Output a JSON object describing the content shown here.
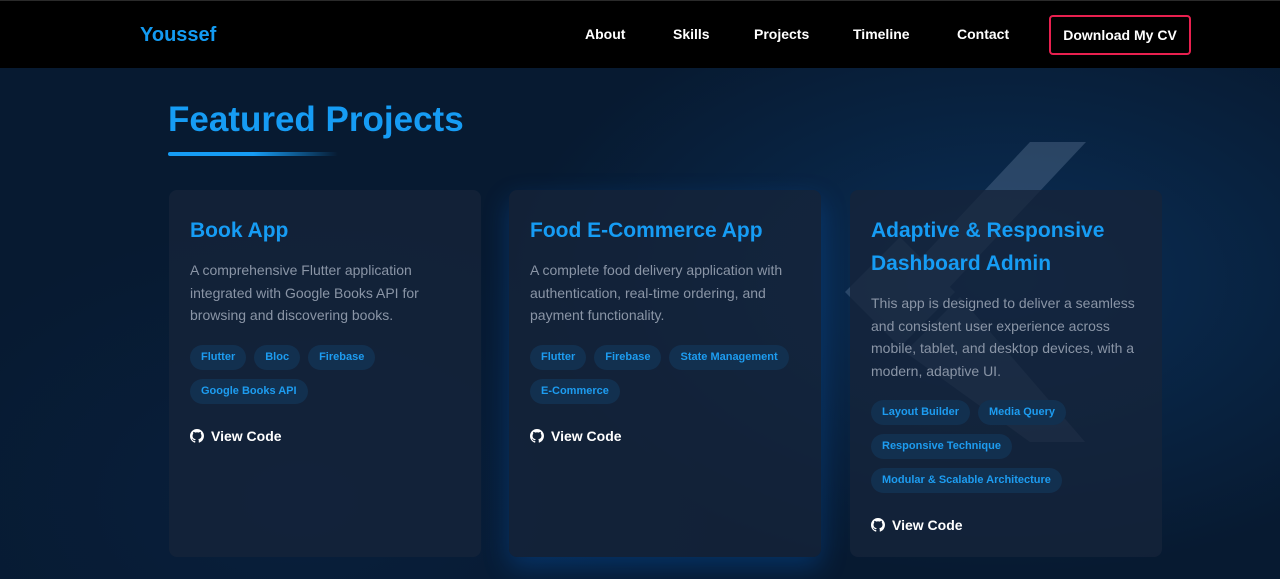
{
  "navbar": {
    "brand": "Youssef",
    "links": [
      {
        "label": "About"
      },
      {
        "label": "Skills"
      },
      {
        "label": "Projects"
      },
      {
        "label": "Timeline"
      },
      {
        "label": "Contact"
      }
    ],
    "cv_button": "Download My CV",
    "accent_color": "#139bf2",
    "cv_border_color": "#e8204f"
  },
  "section": {
    "title": "Featured Projects"
  },
  "projects": [
    {
      "title": "Book App",
      "description": "A comprehensive Flutter application integrated with Google Books API for browsing and discovering books.",
      "tags": [
        "Flutter",
        "Bloc",
        "Firebase",
        "Google Books API"
      ],
      "link_label": "View Code",
      "icon": "github-icon"
    },
    {
      "title": "Food E-Commerce App",
      "description": "A complete food delivery application with authentication, real-time ordering, and payment functionality.",
      "tags": [
        "Flutter",
        "Firebase",
        "State Management",
        "E-Commerce"
      ],
      "link_label": "View Code",
      "icon": "github-icon"
    },
    {
      "title": "Adaptive & Responsive Dashboard Admin",
      "description": "This app is designed to deliver a seamless and consistent user experience across mobile, tablet, and desktop devices, with a modern, adaptive UI.",
      "tags": [
        "Layout Builder",
        "Media Query",
        "Responsive Technique",
        "Modular & Scalable Architecture"
      ],
      "link_label": "View Code",
      "icon": "github-icon"
    }
  ]
}
